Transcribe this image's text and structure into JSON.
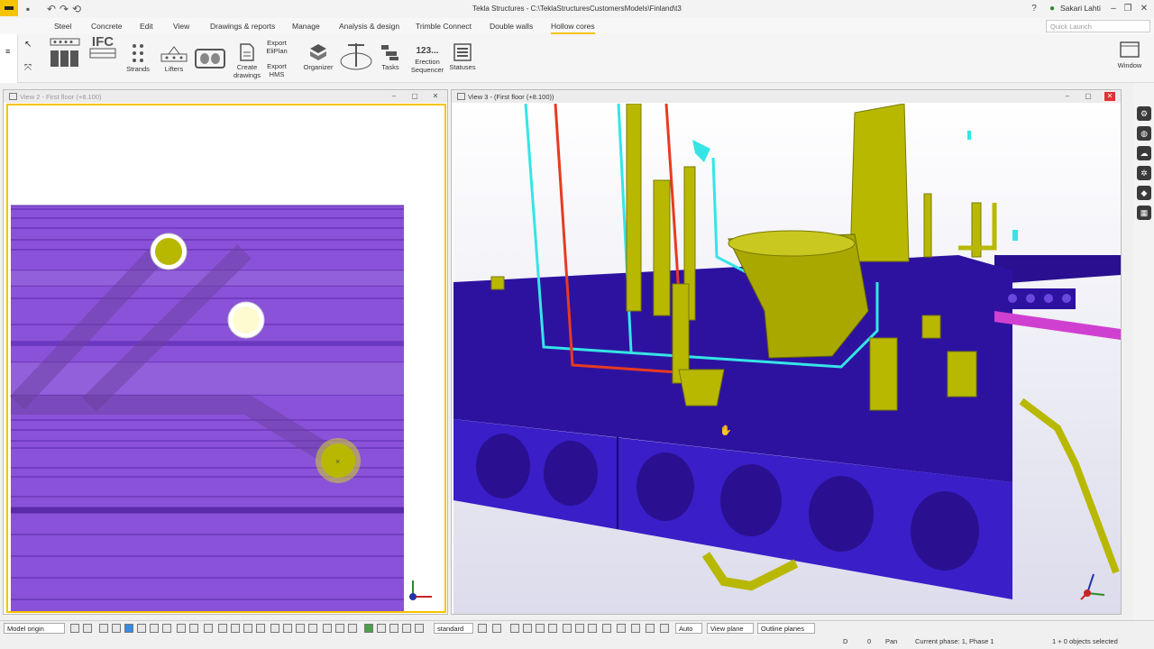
{
  "app": {
    "title": "Tekla Structures - C:\\TeklaStructuresCustomersModels\\Finland\\t3",
    "user": "Sakari Lahti",
    "help": "?"
  },
  "menu": {
    "items": [
      "Steel",
      "Concrete",
      "Edit",
      "View",
      "Drawings & reports",
      "Manage",
      "Analysis & design",
      "Trimble Connect",
      "Double walls",
      "Hollow cores"
    ],
    "active": "Hollow cores",
    "quick_launch_placeholder": "Quick Launch"
  },
  "ribbon": {
    "ifc": "IFC",
    "strands": "Strands",
    "lifters": "Lifters",
    "create_drawings": "Create drawings",
    "export_elliplan": "Export EliPlan",
    "export_hms": "Export HMS",
    "organizer": "Organizer",
    "tasks": "Tasks",
    "erection_sequencer": "Erection Sequencer",
    "erection_icon_text": "123...",
    "statuses": "Statuses",
    "window": "Window"
  },
  "views": {
    "left": {
      "title": "View 2 - First floor (+8.100)"
    },
    "right": {
      "title": "View 3 - (First floor (+8.100))"
    }
  },
  "status": {
    "model_origin": "Model origin",
    "standard": "standard",
    "auto": "Auto",
    "view_plane": "View plane",
    "outline_planes": "Outline planes",
    "d_label": "D",
    "zero": "0",
    "pan": "Pan",
    "phase": "Current phase: 1, Phase 1",
    "selected": "1 + 0 objects selected"
  },
  "colors": {
    "slab_purple": "#3a1ec8",
    "plan_purple": "#8a52d8",
    "pipe_olive": "#b8b800",
    "pipe_cyan": "#35e5e5",
    "pipe_red": "#e83a20",
    "magenta": "#d040d0",
    "accent_yellow": "#f5c400"
  }
}
